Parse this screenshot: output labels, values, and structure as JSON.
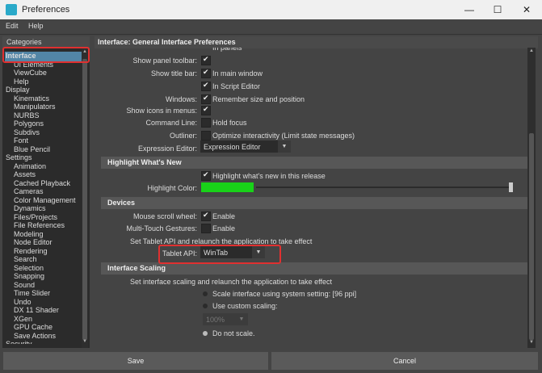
{
  "window": {
    "title": "Preferences",
    "minimize": "—",
    "maximize": "☐",
    "close": "✕"
  },
  "menu": {
    "edit": "Edit",
    "help": "Help"
  },
  "categories": {
    "header": "Categories",
    "items": [
      {
        "label": "Interface",
        "indent": 0,
        "selected": true
      },
      {
        "label": "UI Elements",
        "indent": 1
      },
      {
        "label": "ViewCube",
        "indent": 1
      },
      {
        "label": "Help",
        "indent": 1
      },
      {
        "label": "Display",
        "indent": 0
      },
      {
        "label": "Kinematics",
        "indent": 1
      },
      {
        "label": "Manipulators",
        "indent": 1
      },
      {
        "label": "NURBS",
        "indent": 1
      },
      {
        "label": "Polygons",
        "indent": 1
      },
      {
        "label": "Subdivs",
        "indent": 1
      },
      {
        "label": "Font",
        "indent": 1
      },
      {
        "label": "Blue Pencil",
        "indent": 1
      },
      {
        "label": "Settings",
        "indent": 0
      },
      {
        "label": "Animation",
        "indent": 1
      },
      {
        "label": "Assets",
        "indent": 1
      },
      {
        "label": "Cached Playback",
        "indent": 1
      },
      {
        "label": "Cameras",
        "indent": 1
      },
      {
        "label": "Color Management",
        "indent": 1
      },
      {
        "label": "Dynamics",
        "indent": 1
      },
      {
        "label": "Files/Projects",
        "indent": 1
      },
      {
        "label": "File References",
        "indent": 1
      },
      {
        "label": "Modeling",
        "indent": 1
      },
      {
        "label": "Node Editor",
        "indent": 1
      },
      {
        "label": "Rendering",
        "indent": 1
      },
      {
        "label": "Search",
        "indent": 1
      },
      {
        "label": "Selection",
        "indent": 1
      },
      {
        "label": "Snapping",
        "indent": 1
      },
      {
        "label": "Sound",
        "indent": 1
      },
      {
        "label": "Time Slider",
        "indent": 1
      },
      {
        "label": "Undo",
        "indent": 1
      },
      {
        "label": "DX 11 Shader",
        "indent": 1
      },
      {
        "label": "XGen",
        "indent": 1
      },
      {
        "label": "GPU Cache",
        "indent": 1
      },
      {
        "label": "Save Actions",
        "indent": 1
      },
      {
        "label": "Security",
        "indent": 0
      }
    ]
  },
  "panel": {
    "header": "Interface: General Interface Preferences",
    "general": {
      "partial_top": "In panels",
      "show_panel_toolbar": "Show panel toolbar:",
      "show_title_bar": "Show title bar:",
      "in_main_window": "In main window",
      "in_script_editor": "In Script Editor",
      "windows": "Windows:",
      "remember_size": "Remember size and position",
      "show_icons_in_menus": "Show icons in menus:",
      "command_line": "Command Line:",
      "hold_focus": "Hold focus",
      "outliner": "Outliner:",
      "optimize_interactivity": "Optimize interactivity (Limit state messages)",
      "expression_editor": "Expression Editor:",
      "expression_editor_value": "Expression Editor"
    },
    "highlight": {
      "title": "Highlight What's New",
      "checkbox_label": "Highlight what's new in this release",
      "color_label": "Highlight Color:",
      "color": "#19d219",
      "slider_value": 1.0
    },
    "devices": {
      "title": "Devices",
      "mouse_scroll_wheel": "Mouse scroll wheel:",
      "multi_touch": "Multi-Touch Gestures:",
      "enable": "Enable",
      "tablet_note": "Set Tablet API and relaunch the application to take effect",
      "tablet_api_label": "Tablet API:",
      "tablet_api_value": "WinTab"
    },
    "scaling": {
      "title": "Interface Scaling",
      "note": "Set interface scaling and relaunch the application to take effect",
      "opt_system": "Scale interface using system setting: [96 ppi]",
      "opt_custom": "Use custom scaling:",
      "custom_value": "100%",
      "opt_none": "Do not scale."
    }
  },
  "buttons": {
    "save": "Save",
    "cancel": "Cancel"
  }
}
